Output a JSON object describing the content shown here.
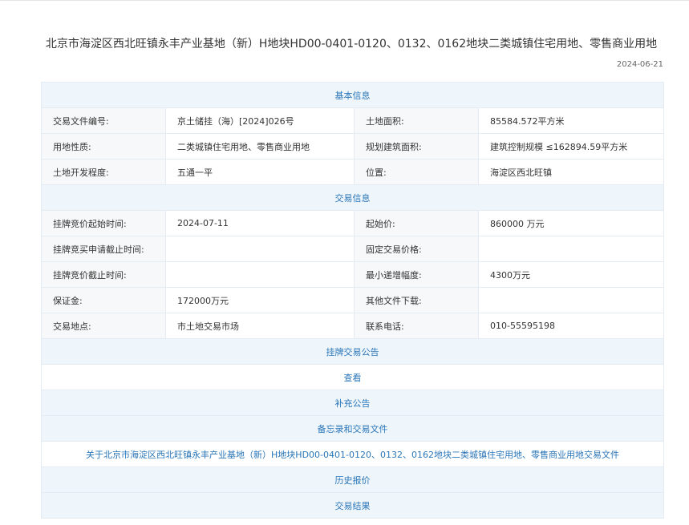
{
  "page": {
    "title": "北京市海淀区西北旺镇永丰产业基地（新）H地块HD00-0401-0120、0132、0162地块二类城镇住宅用地、零售商业用地",
    "date": "2024-06-21"
  },
  "basic": {
    "header": "基本信息",
    "rows": [
      {
        "l1": "交易文件编号:",
        "v1": "京土储挂（海）[2024]026号",
        "l2": "土地面积:",
        "v2": "85584.572平方米"
      },
      {
        "l1": "用地性质:",
        "v1": "二类城镇住宅用地、零售商业用地",
        "l2": "规划建筑面积:",
        "v2": "建筑控制规模 ≤162894.59平方米"
      },
      {
        "l1": "土地开发程度:",
        "v1": "五通一平",
        "l2": "位置:",
        "v2": "海淀区西北旺镇"
      }
    ]
  },
  "trade": {
    "header": "交易信息",
    "rows": [
      {
        "l1": "挂牌竞价起始时间:",
        "v1": "2024-07-11",
        "l2": "起始价:",
        "v2": "860000 万元"
      },
      {
        "l1": "挂牌竞买申请截止时间:",
        "v1": "",
        "l2": "固定交易价格:",
        "v2": ""
      },
      {
        "l1": "挂牌竞价截止时间:",
        "v1": "",
        "l2": "最小递增幅度:",
        "v2": "4300万元"
      },
      {
        "l1": "保证金:",
        "v1": "172000万元",
        "l2": "其他文件下载:",
        "v2": ""
      },
      {
        "l1": "交易地点:",
        "v1": "市土地交易市场",
        "l2": "联系电话:",
        "v2": "010-55595198"
      }
    ]
  },
  "notice": {
    "header": "挂牌交易公告",
    "view_link": "查看"
  },
  "supplement": {
    "header": "补充公告"
  },
  "memo": {
    "header": "备忘录和交易文件",
    "file_link": "关于北京市海淀区西北旺镇永丰产业基地（新）H地块HD00-0401-0120、0132、0162地块二类城镇住宅用地、零售商业用地交易文件"
  },
  "history": {
    "header": "历史报价"
  },
  "result": {
    "header": "交易结果"
  }
}
